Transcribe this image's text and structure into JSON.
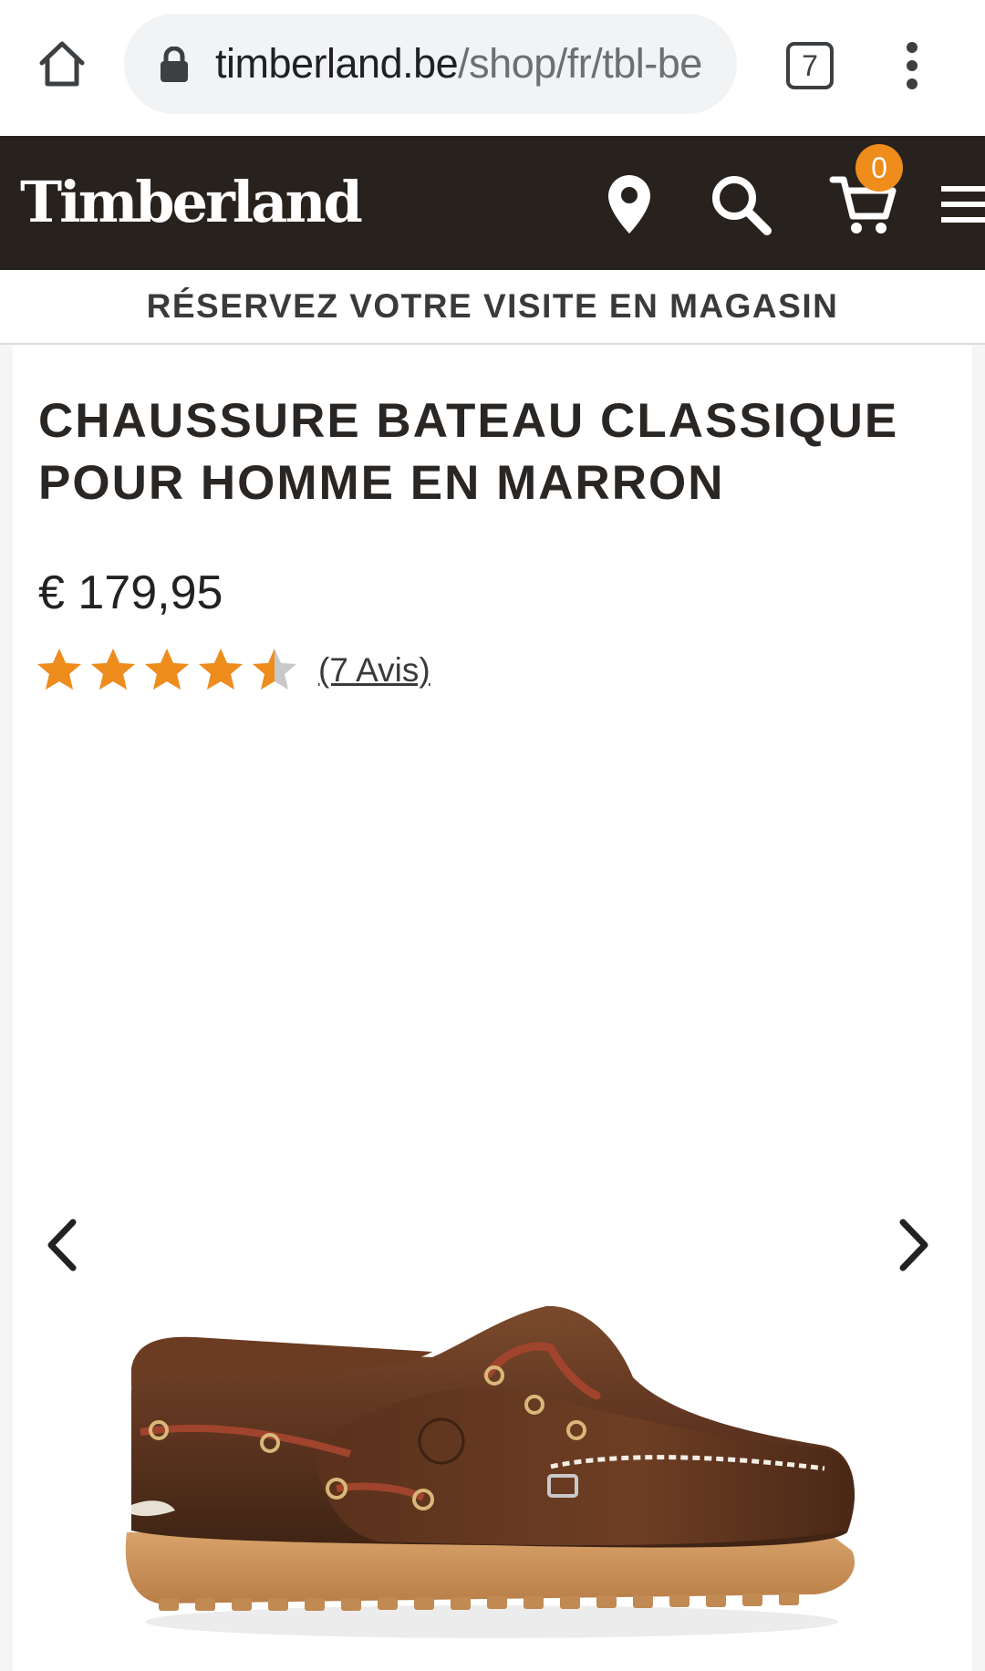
{
  "browser": {
    "url_domain": "timberland.be",
    "url_path": "/shop/fr/tbl-be",
    "tab_count": "7"
  },
  "header": {
    "brand": "Timberland",
    "cart_count": "0"
  },
  "promo": {
    "text": "RÉSERVEZ VOTRE VISITE EN MAGASIN"
  },
  "product": {
    "title": "CHAUSSURE BATEAU CLASSIQUE POUR HOMME EN MARRON",
    "price": "€ 179,95",
    "rating": 4.5,
    "rating_max": 5,
    "reviews_label": "(7 Avis)"
  },
  "colors": {
    "header_bg": "#28221e",
    "accent_orange": "#ee8c1c",
    "star_empty": "#c8c8c8"
  },
  "icons": {
    "home": "home-icon",
    "lock": "lock-icon",
    "tabs": "tabs-icon",
    "menu": "more-vertical-icon",
    "location": "map-pin-icon",
    "search": "search-icon",
    "cart": "shopping-cart-icon",
    "hamburger": "hamburger-menu-icon",
    "prev": "chevron-left-icon",
    "next": "chevron-right-icon"
  }
}
